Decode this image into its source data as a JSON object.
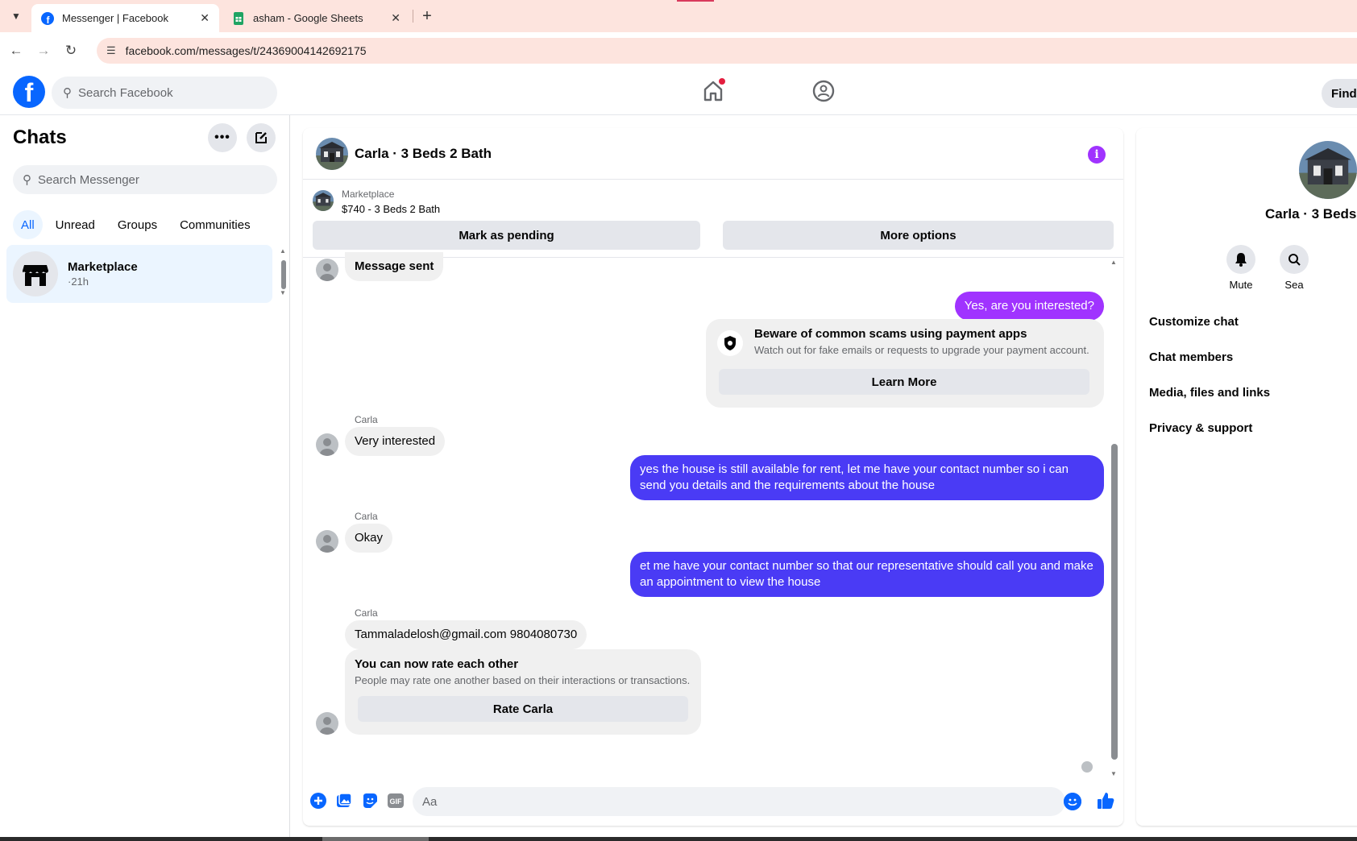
{
  "browser": {
    "tabs": [
      {
        "title": "Messenger | Facebook",
        "active": true
      },
      {
        "title": "asham - Google Sheets",
        "active": false
      }
    ],
    "url": "facebook.com/messages/t/24369004142692175"
  },
  "fb_nav": {
    "search_placeholder": "Search Facebook",
    "find_label": "Find"
  },
  "sidebar": {
    "title": "Chats",
    "search_placeholder": "Search Messenger",
    "filters": [
      "All",
      "Unread",
      "Groups",
      "Communities"
    ],
    "chats": [
      {
        "name": "Marketplace",
        "time": "·21h"
      }
    ]
  },
  "conversation": {
    "title": "Carla · 3 Beds 2 Bath",
    "marketplace": {
      "label": "Marketplace",
      "listing": "$740 - 3 Beds 2 Bath",
      "pending_label": "Mark as pending",
      "options_label": "More options"
    },
    "messages": {
      "m1": "Message sent",
      "m2": "Yes, are you interested?",
      "sender": "Carla",
      "m3": "Very interested",
      "m4": "yes the house is still available for rent, let me have your contact number so i can send you details and the requirements about the house",
      "m5": "Okay",
      "m6": "et me have your contact number so that our representative should call you and make an appointment to view the house",
      "m7": "Tammaladelosh@gmail.com 9804080730"
    },
    "scam_notice": {
      "title": "Beware of common scams using payment apps",
      "subtitle": "Watch out for fake emails or requests to upgrade your payment account.",
      "button": "Learn More"
    },
    "rate_notice": {
      "title": "You can now rate each other",
      "subtitle": "People may rate one another based on their interactions or transactions.",
      "button": "Rate Carla"
    },
    "composer_placeholder": "Aa",
    "colors": {
      "outgoing_purple": "#a033ff",
      "outgoing_blue": "#4a3bf5",
      "accent": "#0866ff"
    }
  },
  "right_panel": {
    "name": "Carla · 3 Beds 2",
    "actions": [
      "Mute",
      "Sea"
    ],
    "items": [
      "Customize chat",
      "Chat members",
      "Media, files and links",
      "Privacy & support"
    ]
  }
}
